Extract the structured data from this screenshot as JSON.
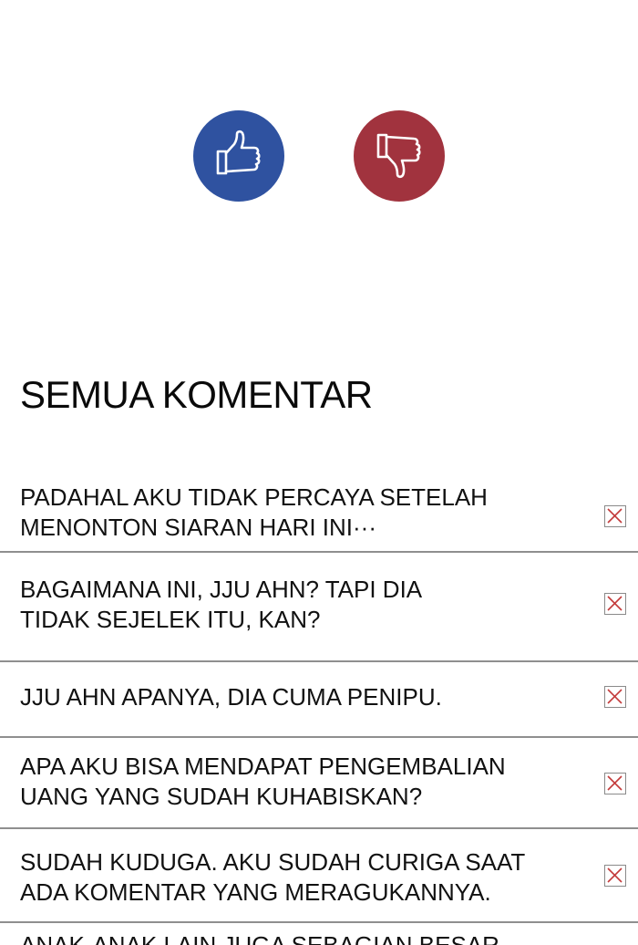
{
  "vote": {
    "like_icon": "thumbs-up-icon",
    "dislike_icon": "thumbs-down-icon",
    "like_color": "#2f52a0",
    "dislike_color": "#a1333e"
  },
  "comments_section": {
    "title": "SEMUA KOMENTAR",
    "delete_icon": "close-box-icon",
    "items": [
      {
        "text": "PADAHAL AKU TIDAK PERCAYA SETELAH\nMENONTON SIARAN HARI INI···"
      },
      {
        "text": "BAGAIMANA INI, JJU AHN? TAPI DIA\nTIDAK SEJELEK ITU, KAN?"
      },
      {
        "text": "JJU AHN APANYA, DIA CUMA PENIPU."
      },
      {
        "text": "APA AKU BISA MENDAPAT PENGEMBALIAN\nUANG YANG SUDAH KUHABISKAN?"
      },
      {
        "text": "SUDAH KUDUGA. AKU SUDAH CURIGA SAAT\nADA KOMENTAR YANG MERAGUKANNYA."
      },
      {
        "text": "ANAK-ANAK LAIN JUGA SEBAGIAN BESAR"
      }
    ]
  }
}
